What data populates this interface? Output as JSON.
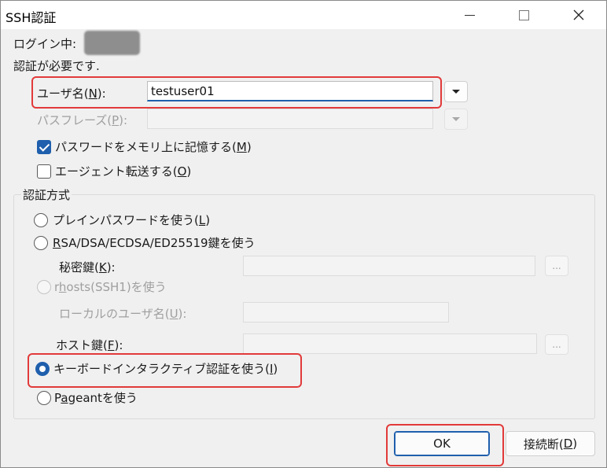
{
  "window": {
    "title": "SSH認証"
  },
  "status": {
    "logged_in_label": "ログイン中:",
    "auth_required": "認証が必要です."
  },
  "username": {
    "label_prefix": "ユーザ名(",
    "mnemonic": "N",
    "label_suffix": "):",
    "value": "testuser01"
  },
  "passphrase": {
    "label_prefix": "パスフレーズ(",
    "mnemonic": "P",
    "label_suffix": "):",
    "value": ""
  },
  "options": {
    "remember_prefix": "パスワードをメモリ上に記憶する(",
    "remember_mnemonic": "M",
    "remember_suffix": ")",
    "remember_checked": true,
    "agent_prefix": "エージェント転送する(",
    "agent_mnemonic": "O",
    "agent_suffix": ")",
    "agent_checked": false
  },
  "auth_method": {
    "title": "認証方式",
    "plain_prefix": "プレインパスワードを使う(",
    "plain_mnemonic": "L",
    "plain_suffix": ")",
    "rsa_mnemonic": "R",
    "rsa_rest": "SA/DSA/ECDSA/ED25519鍵を使う",
    "privkey_prefix": "秘密鍵(",
    "privkey_mnemonic": "K",
    "privkey_suffix": "):",
    "rhosts_pre": "r",
    "rhosts_mnemonic": "h",
    "rhosts_rest": "osts(SSH1)を使う",
    "localuser_prefix": "ローカルのユーザ名(",
    "localuser_mnemonic": "U",
    "localuser_suffix": "):",
    "hostkey_prefix": "ホスト鍵(",
    "hostkey_mnemonic": "F",
    "hostkey_suffix": "):",
    "kbd_prefix": "キーボードインタラクティブ認証を使う(",
    "kbd_mnemonic": "I",
    "kbd_suffix": ")",
    "pageant_pre": "P",
    "pageant_mnemonic": "a",
    "pageant_rest": "geantを使う",
    "selected": "keyboard-interactive",
    "browse_label": "..."
  },
  "buttons": {
    "ok": "OK",
    "disconnect_prefix": "接続断(",
    "disconnect_mnemonic": "D",
    "disconnect_suffix": ")"
  },
  "colors": {
    "accent": "#1f5fad",
    "highlight": "#e23a3a",
    "background": "#f0f0f0"
  }
}
